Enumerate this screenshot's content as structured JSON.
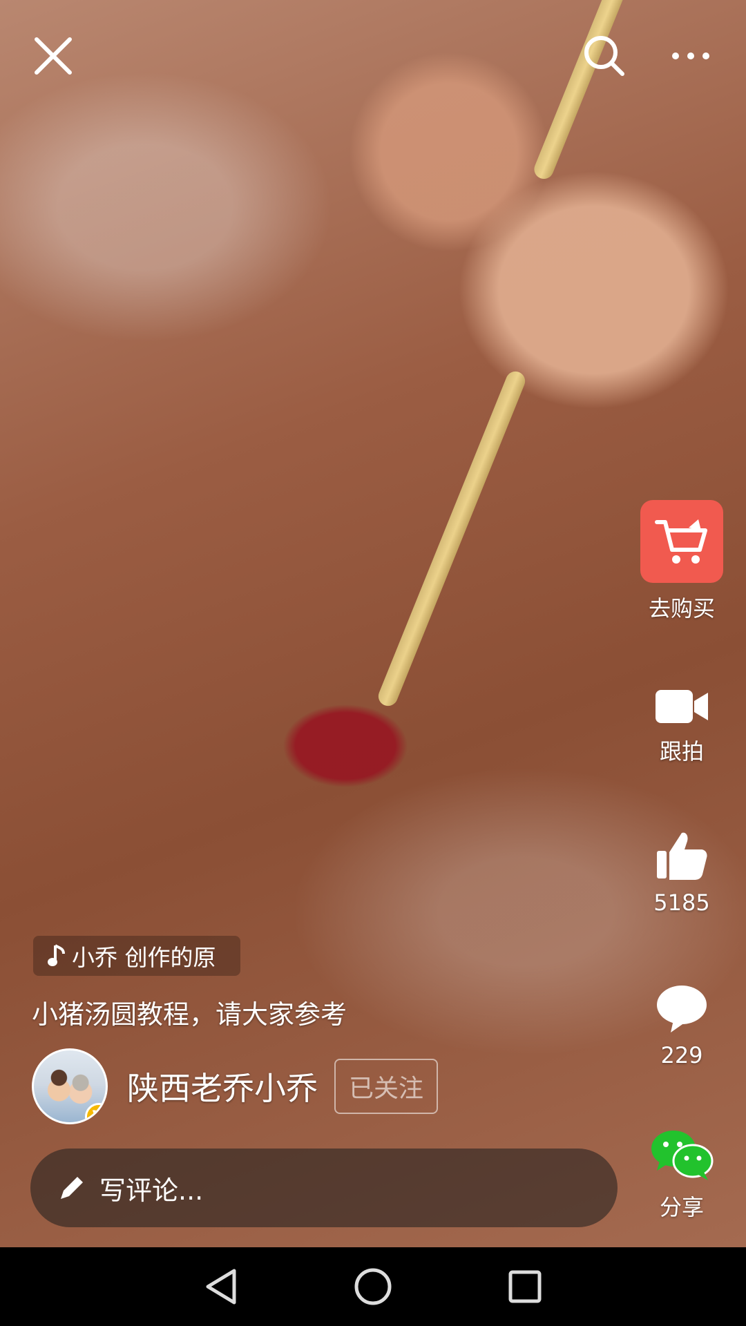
{
  "icons": {
    "close": "close-icon",
    "search": "search-icon",
    "more": "more-icon",
    "cart": "shopping-cart-icon",
    "video": "video-camera-icon",
    "like": "thumbs-up-icon",
    "comment": "comment-bubble-icon",
    "wechat": "wechat-icon",
    "music": "music-note-icon",
    "pen": "pen-icon",
    "back": "back-triangle-icon",
    "home": "home-circle-icon",
    "recents": "recents-square-icon"
  },
  "colors": {
    "buy_button": "#f15a4f",
    "verified_badge": "#f5b800",
    "wechat_green": "#22c22d"
  },
  "rail": {
    "buy_label": "去购买",
    "duet_label": "跟拍",
    "like_count": "5185",
    "comment_count": "229",
    "share_label": "分享"
  },
  "video_info": {
    "music_label": "小乔 创作的原",
    "caption": "小猪汤圆教程，请大家参考",
    "author_name": "陕西老乔小乔",
    "verified_mark": "V",
    "follow_label": "已关注"
  },
  "comment_input": {
    "placeholder": "写评论..."
  }
}
